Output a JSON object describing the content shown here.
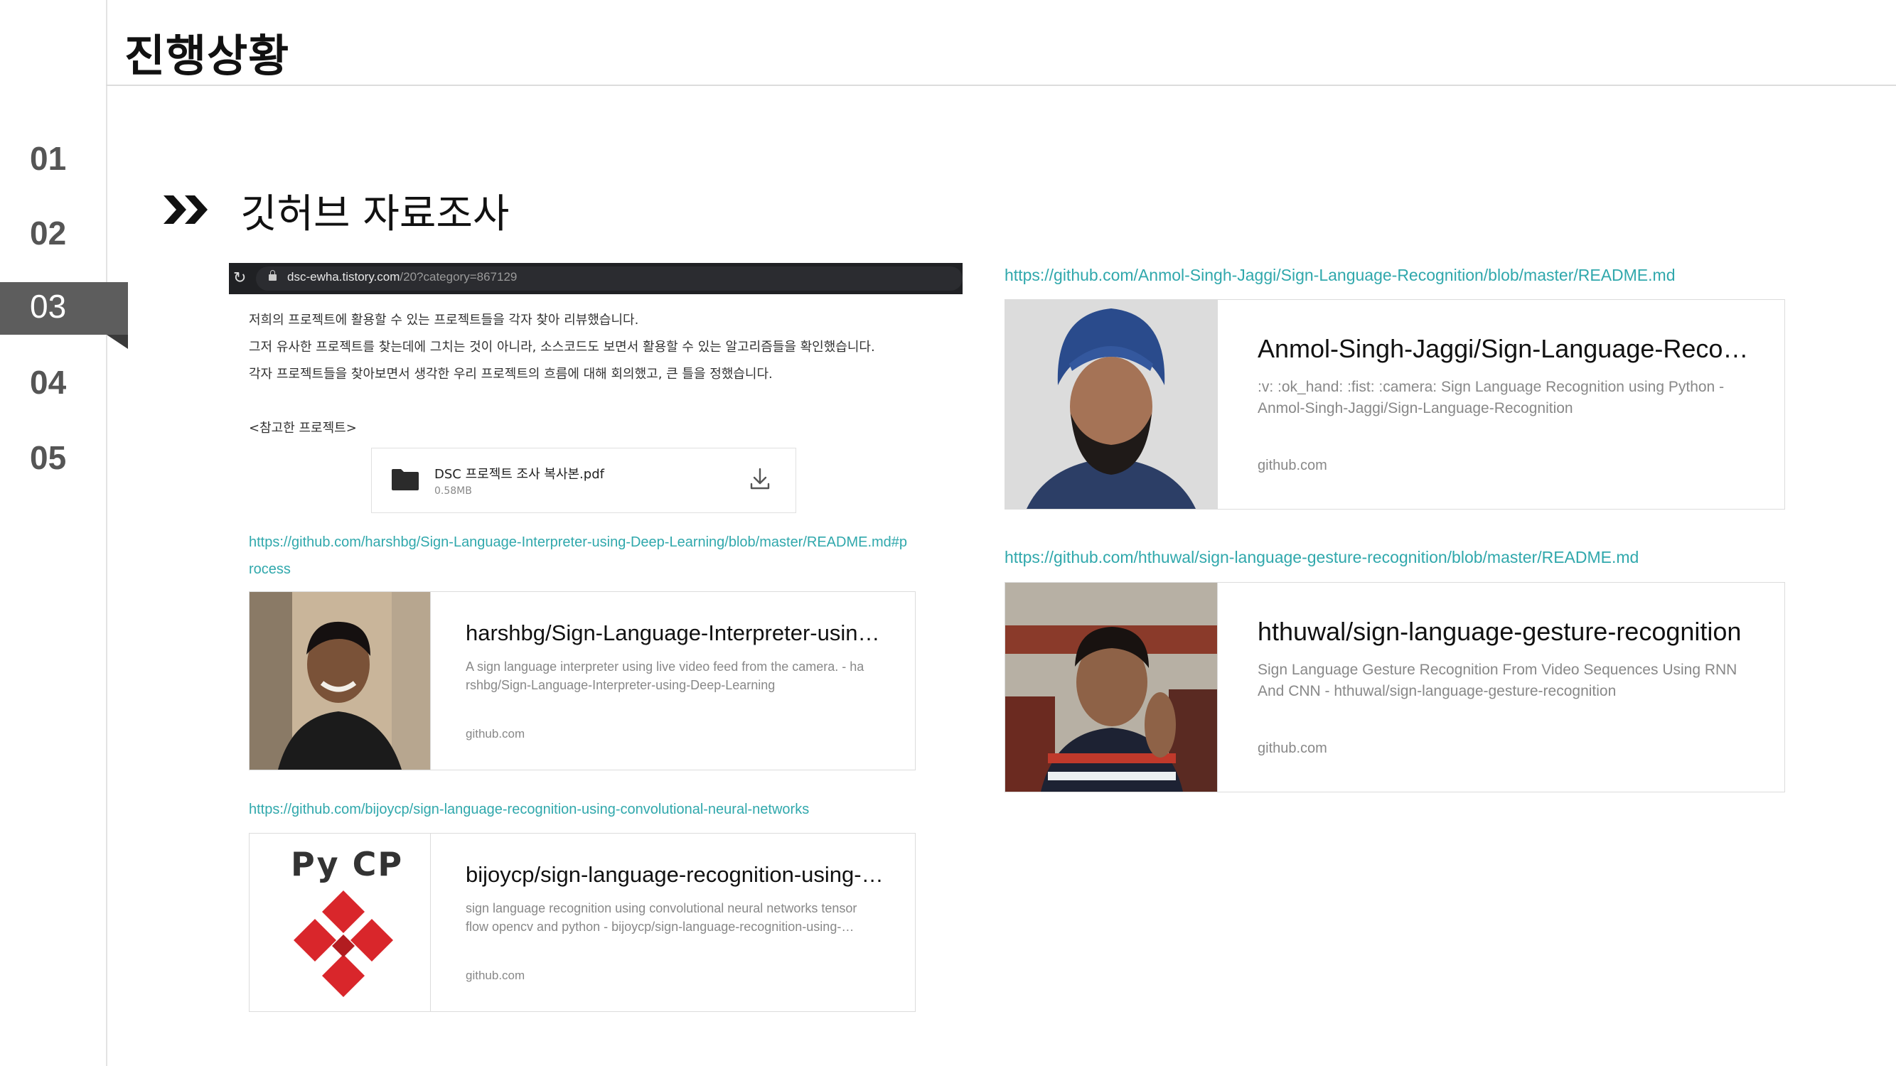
{
  "header": {
    "title": "진행상황"
  },
  "nav": {
    "items": [
      "01",
      "02",
      "03",
      "04",
      "05"
    ],
    "active": "03"
  },
  "section": {
    "title": "깃허브 자료조사"
  },
  "browser": {
    "url_host": "dsc-ewha.tistory.com",
    "url_path": "/20?category=867129",
    "paragraphs": [
      "저희의 프로젝트에 활용할 수 있는 프로젝트들을 각자 찾아 리뷰했습니다.",
      "그저 유사한 프로젝트를 찾는데에 그치는 것이 아니라, 소스코드도 보면서 활용할 수 있는 알고리즘들을 확인했습니다.",
      "각자 프로젝트들을 찾아보면서 생각한 우리 프로젝트의 흐름에 대해 회의했고, 큰 틀을 정했습니다."
    ],
    "reference_label": "<참고한 프로젝트>",
    "file": {
      "name": "DSC 프로젝트 조사 복사본.pdf",
      "size": "0.58MB"
    },
    "links": [
      {
        "url_line1": "https://github.com/harshbg/Sign-Language-Interpreter-using-Deep-Learning/blob/master/README.md#p",
        "url_line2": "rocess",
        "title": "harshbg/Sign-Language-Interpreter-using…",
        "desc_line1": "A sign language interpreter using live video feed from the camera. - ha",
        "desc_line2": "rshbg/Sign-Language-Interpreter-using-Deep-Learning",
        "domain": "github.com"
      },
      {
        "url_line1": "https://github.com/bijoycp/sign-language-recognition-using-convolutional-neural-networks",
        "title": "bijoycp/sign-language-recognition-using-…",
        "desc_line1": "sign language recognition using convolutional neural networks tensor",
        "desc_line2": "flow opencv and python - bijoycp/sign-language-recognition-using-…",
        "domain": "github.com",
        "thumb_text": "Py CP"
      }
    ]
  },
  "right_links": [
    {
      "url": "https://github.com/Anmol-Singh-Jaggi/Sign-Language-Recognition/blob/master/README.md",
      "title": "Anmol-Singh-Jaggi/Sign-Language-Recog…",
      "desc_line1": ":v: :ok_hand: :fist: :camera: Sign Language Recognition using Python -",
      "desc_line2": "Anmol-Singh-Jaggi/Sign-Language-Recognition",
      "domain": "github.com"
    },
    {
      "url": "https://github.com/hthuwal/sign-language-gesture-recognition/blob/master/README.md",
      "title": "hthuwal/sign-language-gesture-recognition",
      "desc_line1": "Sign Language Gesture Recognition From Video Sequences Using RNN",
      "desc_line2": "And CNN - hthuwal/sign-language-gesture-recognition",
      "domain": "github.com"
    }
  ],
  "colors": {
    "link": "#30a8ac",
    "nav_active_bg": "#5d5d5d",
    "browser_bar": "#202124"
  }
}
